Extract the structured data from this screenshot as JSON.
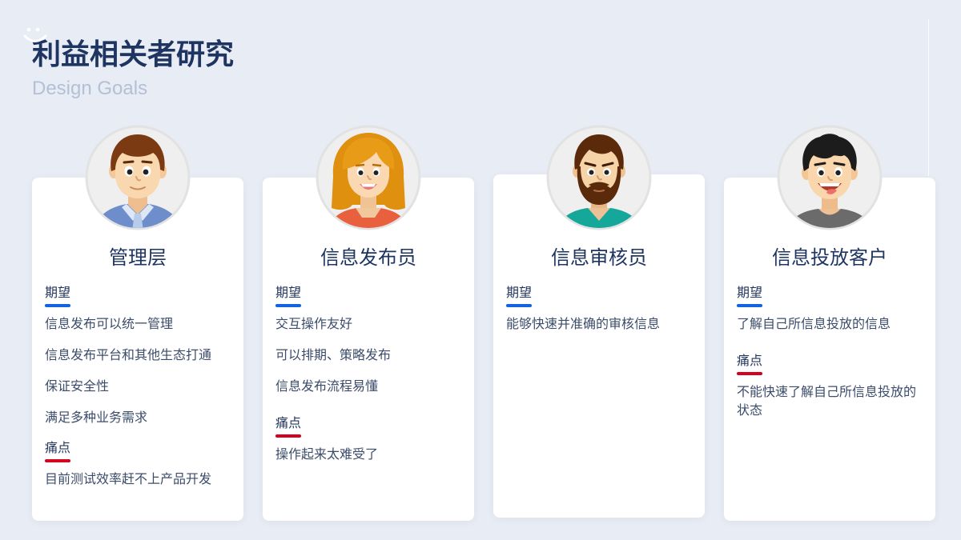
{
  "header": {
    "logo_icon": "smiley-icon",
    "title": "利益相关者研究",
    "subtitle": "Design Goals"
  },
  "colors": {
    "background": "#e8ecf4",
    "card": "#ffffff",
    "title": "#1e3561",
    "subtitle": "#b3c0d6",
    "label": "#24375e",
    "text": "#3c4c6a",
    "expectation_bar": "#1463e0",
    "pain_bar": "#d4021d"
  },
  "cards": [
    {
      "avatar_icon": "manager-avatar-icon",
      "name": "管理层",
      "sections": [
        {
          "label": "期望",
          "items": [
            "信息发布可以统一管理",
            "信息发布平台和其他生态打通",
            "保证安全性",
            "满足多种业务需求"
          ]
        },
        {
          "label": "痛点",
          "items": [
            "目前测试效率赶不上产品开发"
          ]
        }
      ]
    },
    {
      "avatar_icon": "publisher-avatar-icon",
      "name": "信息发布员",
      "sections": [
        {
          "label": "期望",
          "items": [
            "交互操作友好",
            "可以排期、策略发布",
            "信息发布流程易懂"
          ]
        },
        {
          "label": "痛点",
          "items": [
            "操作起来太难受了"
          ]
        }
      ]
    },
    {
      "avatar_icon": "reviewer-avatar-icon",
      "name": "信息审核员",
      "sections": [
        {
          "label": "期望",
          "items": [
            "能够快速并准确的审核信息"
          ]
        }
      ]
    },
    {
      "avatar_icon": "client-avatar-icon",
      "name": "信息投放客户",
      "sections": [
        {
          "label": "期望",
          "items": [
            "了解自己所信息投放的信息"
          ]
        },
        {
          "label": "痛点",
          "items": [
            "不能快速了解自己所信息投放的状态"
          ]
        }
      ]
    }
  ]
}
